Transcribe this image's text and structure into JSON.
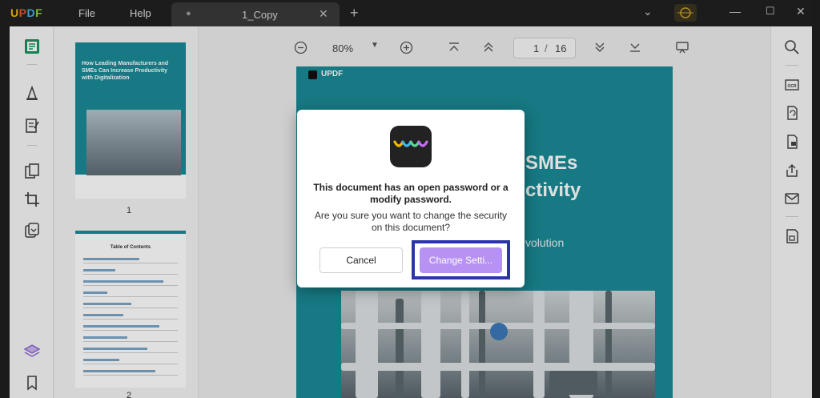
{
  "app": {
    "logo": "UPDF",
    "menu": [
      "File",
      "Help"
    ],
    "tab_title": "1_Copy"
  },
  "toolbar": {
    "zoom": "80%",
    "current_page": "1",
    "separator": "/",
    "total_pages": "16"
  },
  "thumbnails": {
    "page1_title": "How Leading Manufacturers and SMEs Can Increase Productivity with Digitalization",
    "page1_number": "1",
    "page2_title": "Table of Contents",
    "page2_number": "2"
  },
  "document": {
    "brand": "UPDF",
    "title_line1": "SMEs",
    "title_line2": "ctivity",
    "subtitle": "volution"
  },
  "dialog": {
    "title": "This document has an open password or a modify password.",
    "message": "Are you sure you want to change the security on this document?",
    "cancel_label": "Cancel",
    "confirm_label": "Change Setti..."
  },
  "colors": {
    "teal": "#1a8a96",
    "accent_purple": "#b792f2",
    "highlight_border": "#2d34a8"
  }
}
